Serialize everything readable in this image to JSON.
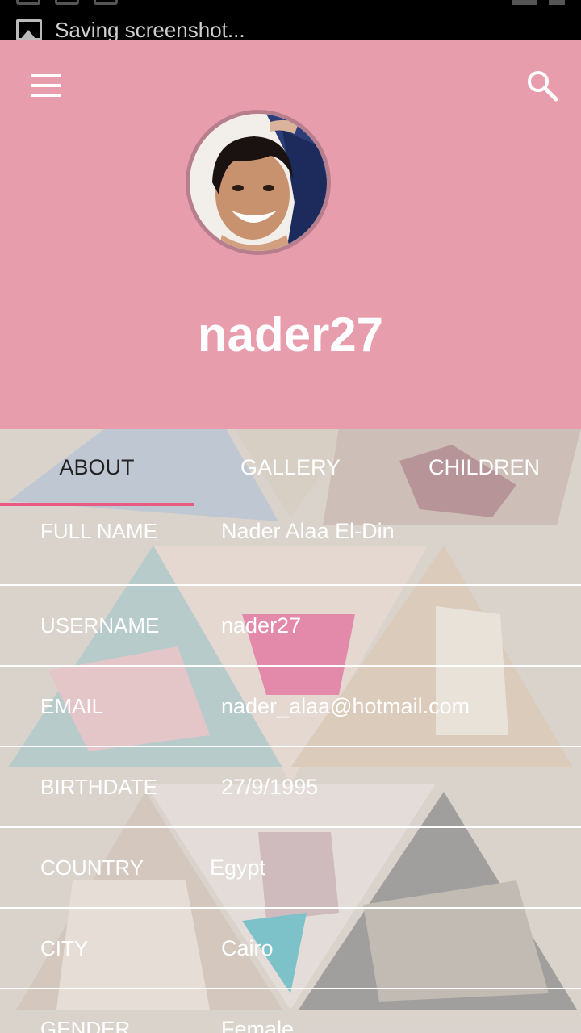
{
  "notification": {
    "text": "Saving screenshot..."
  },
  "header": {
    "username": "nader27",
    "bg_color": "#e79dac"
  },
  "tabs": [
    {
      "label": "ABOUT",
      "active": true
    },
    {
      "label": "GALLERY",
      "active": false
    },
    {
      "label": "CHILDREN",
      "active": false
    }
  ],
  "profile": {
    "rows": [
      {
        "label": "FULL NAME",
        "value": "Nader Alaa El-Din"
      },
      {
        "label": "USERNAME",
        "value": "nader27"
      },
      {
        "label": "EMAIL",
        "value": "nader_alaa@hotmail.com"
      },
      {
        "label": "BIRTHDATE",
        "value": "27/9/1995"
      },
      {
        "label": "COUNTRY",
        "value": "Egypt"
      },
      {
        "label": "CITY",
        "value": "Cairo"
      },
      {
        "label": "GENDER",
        "value": "Female"
      }
    ]
  },
  "colors": {
    "accent": "#e85a82"
  }
}
